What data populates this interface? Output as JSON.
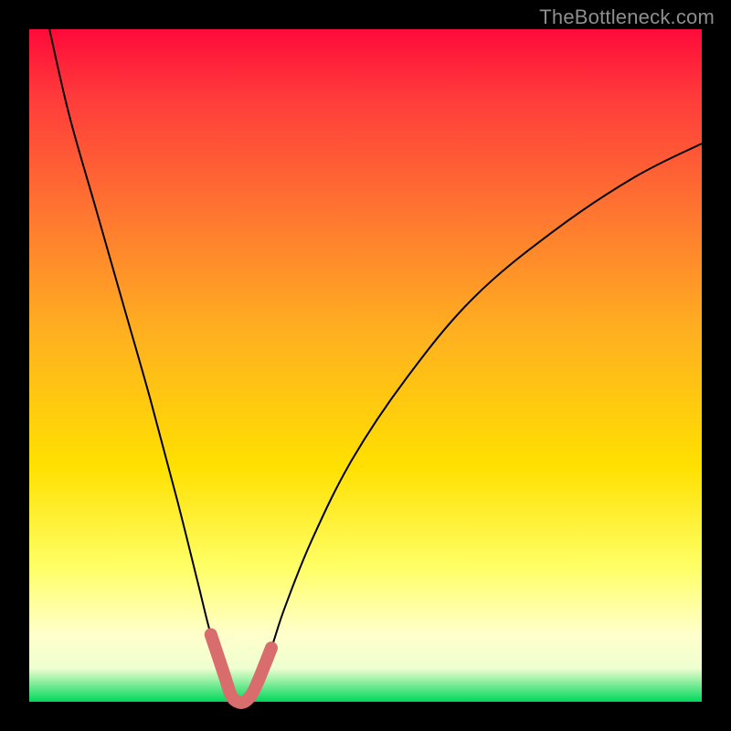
{
  "watermark": {
    "text": "TheBottleneck.com"
  },
  "colors": {
    "page_bg": "#000000",
    "gradient_top": "#ff0a3a",
    "gradient_bottom": "#00d85a",
    "curve": "#000000",
    "trough_highlight": "#d96d6d",
    "watermark": "#8e8e8e"
  },
  "chart_data": {
    "type": "line",
    "title": "",
    "xlabel": "",
    "ylabel": "",
    "xlim": [
      0,
      100
    ],
    "ylim": [
      0,
      100
    ],
    "annotations": [],
    "series": [
      {
        "name": "bottleneck-curve",
        "x": [
          3,
          6,
          10,
          14,
          18,
          22,
          25,
          27,
          29,
          30,
          31,
          32,
          33,
          34,
          36,
          38,
          42,
          48,
          56,
          66,
          78,
          90,
          100
        ],
        "y": [
          100,
          87,
          73,
          59,
          45,
          30,
          18,
          10,
          4,
          1,
          0,
          0,
          1,
          3,
          8,
          14,
          24,
          36,
          48,
          60,
          70,
          78,
          83
        ]
      }
    ],
    "trough_highlight": {
      "x": [
        27,
        29,
        30,
        31,
        32,
        33,
        34,
        36
      ],
      "y": [
        10,
        4,
        1,
        0,
        0,
        1,
        3,
        8
      ]
    }
  }
}
